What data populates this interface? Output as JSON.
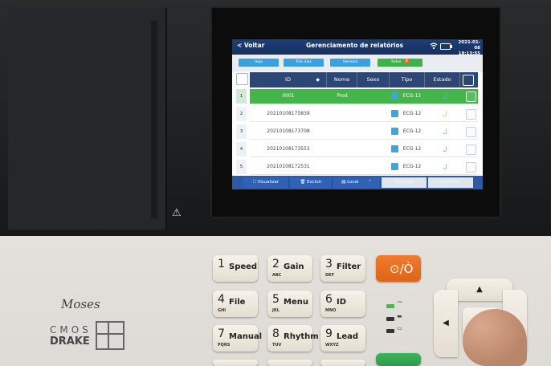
{
  "screen": {
    "back_label": "< Voltar",
    "title": "Gerenciamento de relatórios",
    "date": "2021-01-08",
    "time": "18:13:55",
    "filters": [
      {
        "label": "Hoje"
      },
      {
        "label": "Três dias"
      },
      {
        "label": "Semana"
      },
      {
        "label": "Todos",
        "count": "8"
      }
    ],
    "columns": [
      "ID",
      "Nome",
      "Sexo",
      "Tipo",
      "Estado"
    ],
    "rows": [
      {
        "num": "1",
        "id": "0001",
        "nome": "Prod",
        "sexo": "",
        "tipo": "ECG-12",
        "selected": true
      },
      {
        "num": "2",
        "id": "20210108175839",
        "nome": "",
        "sexo": "",
        "tipo": "ECG-12",
        "selected": false
      },
      {
        "num": "3",
        "id": "20210108173708",
        "nome": "",
        "sexo": "",
        "tipo": "ECG-12",
        "selected": false
      },
      {
        "num": "4",
        "id": "20210108173553",
        "nome": "",
        "sexo": "",
        "tipo": "ECG-12",
        "selected": false
      },
      {
        "num": "5",
        "id": "20210108172531",
        "nome": "",
        "sexo": "",
        "tipo": "ECG-12",
        "selected": false
      }
    ],
    "bottom": {
      "visualizar": "Visualizar",
      "excluir": "Excluir",
      "local": "Local",
      "transmit": "Transmit",
      "exportar": "Exportar"
    }
  },
  "device": {
    "brand_moses": "Moses",
    "brand_cmos": "CMOS",
    "brand_drake": "DRAKE",
    "keys": [
      {
        "num": "1",
        "label": "Speed",
        "sub": ""
      },
      {
        "num": "2",
        "label": "Gain",
        "sub": "ABC"
      },
      {
        "num": "3",
        "label": "Filter",
        "sub": "DEF"
      },
      {
        "num": "4",
        "label": "File",
        "sub": "GHI"
      },
      {
        "num": "5",
        "label": "Menu",
        "sub": "JKL"
      },
      {
        "num": "6",
        "label": "ID",
        "sub": "MNO"
      },
      {
        "num": "7",
        "label": "Manual",
        "sub": "PQRS"
      },
      {
        "num": "8",
        "label": "Rhythm",
        "sub": "TUV"
      },
      {
        "num": "9",
        "label": "Lead",
        "sub": "WXYZ"
      }
    ],
    "power_symbol": "⊙/Ò"
  },
  "colors": {
    "selected_row": "#43b54a",
    "header": "#2c4775",
    "power_key": "#ec6e22"
  }
}
